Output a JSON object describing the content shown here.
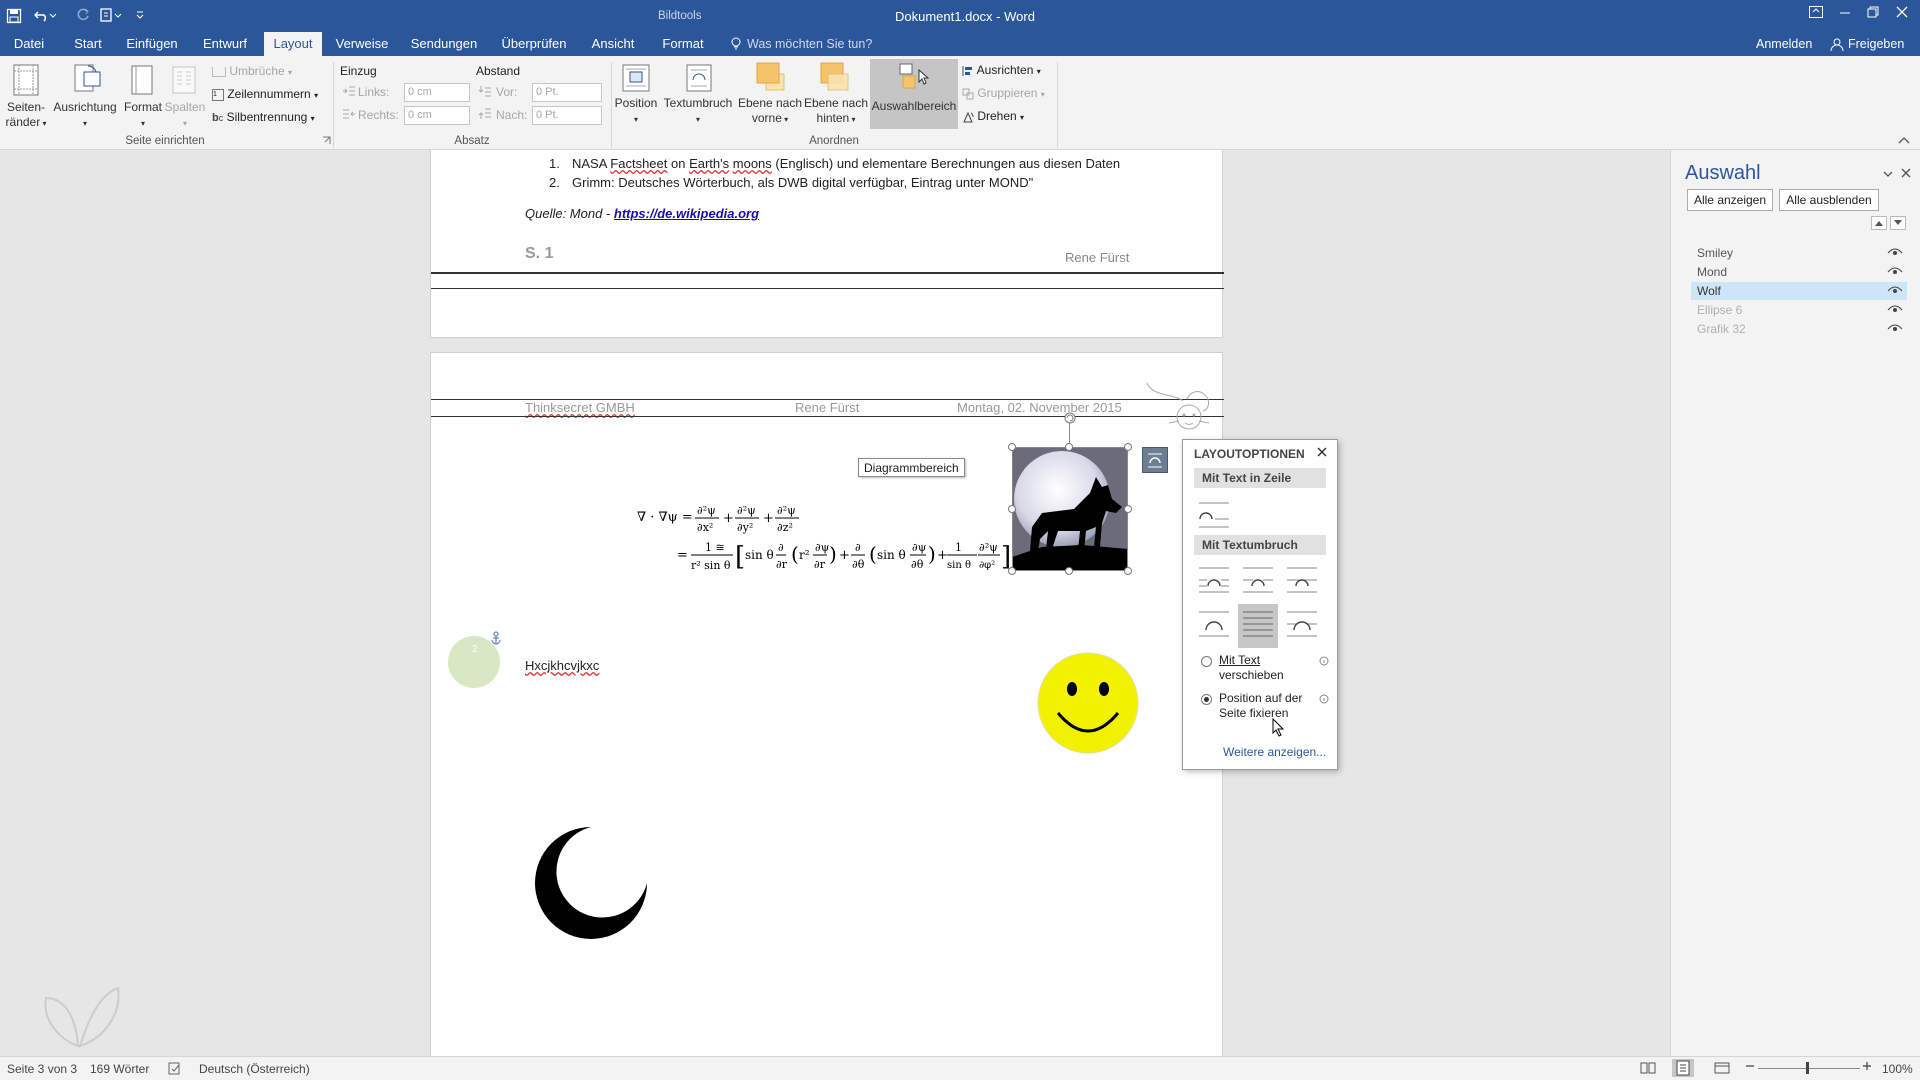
{
  "titlebar": {
    "tool_context": "Bildtools",
    "document_title": "Dokument1.docx - Word"
  },
  "tabs": [
    {
      "label": "Datei"
    },
    {
      "label": "Start"
    },
    {
      "label": "Einfügen"
    },
    {
      "label": "Entwurf"
    },
    {
      "label": "Layout"
    },
    {
      "label": "Verweise"
    },
    {
      "label": "Sendungen"
    },
    {
      "label": "Überprüfen"
    },
    {
      "label": "Ansicht"
    },
    {
      "label": "Format"
    }
  ],
  "tellme": "Was möchten Sie tun?",
  "account": {
    "signin": "Anmelden",
    "share": "Freigeben"
  },
  "ribbon": {
    "seite": {
      "margins": "Seiten-",
      "margins2": "ränder",
      "orientation": "Ausrichtung",
      "size": "Format",
      "columns": "Spalten",
      "breaks": "Umbrüche",
      "line_numbers": "Zeilennummern",
      "hyphenation": "Silbentrennung",
      "group": "Seite einrichten"
    },
    "absatz": {
      "indent": "Einzug",
      "spacing": "Abstand",
      "left": "Links:",
      "right": "Rechts:",
      "before": "Vor:",
      "after": "Nach:",
      "left_val": "0 cm",
      "right_val": "0 cm",
      "before_val": "0 Pt.",
      "after_val": "0 Pt.",
      "group": "Absatz"
    },
    "anordnen": {
      "position": "Position",
      "wrap": "Textumbruch",
      "forward1": "Ebene nach",
      "forward2": "vorne",
      "backward1": "Ebene nach",
      "backward2": "hinten",
      "selection_pane": "Auswahlbereich",
      "align": "Ausrichten",
      "group_btn": "Gruppieren",
      "rotate": "Drehen",
      "group": "Anordnen"
    }
  },
  "page1": {
    "item1_num": "1.",
    "item1_a": "NASA ",
    "item1_b": "Factsheet",
    "item1_c": " on ",
    "item1_d": "Earth's",
    "item1_e": " ",
    "item1_f": "moons",
    "item1_g": " (Englisch) und elementare Berechnungen aus diesen Daten",
    "item2_num": "2.",
    "item2": "Grimm: Deutsches Wörterbuch, als DWB digital verfügbar, Eintrag unter MOND\"",
    "source_prefix": "Quelle: Mond - ",
    "source_link": "https://de.wikipedia.org",
    "footer_page": "S. 1",
    "footer_author": "Rene Fürst"
  },
  "page2": {
    "header_company": "Thinksecret GMBH",
    "header_author": "Rene Fürst",
    "header_date": "Montag, 02. November 2015",
    "chart_area": "Diagrammbereich",
    "body_text": "Hxcjkhcvjkxc",
    "circle_number": "2"
  },
  "layout_options": {
    "title": "LAYOUTOPTIONEN",
    "inline": "Mit Text in Zeile",
    "wrapping": "Mit Textumbruch",
    "move_with_text1": "Mit Text",
    "move_with_text2": "verschieben",
    "fix_position1": "Position auf der",
    "fix_position2": "Seite fixieren",
    "more": "Weitere anzeigen...",
    "selected": "fix_position"
  },
  "selection_pane": {
    "title": "Auswahl",
    "show_all": "Alle anzeigen",
    "hide_all": "Alle ausblenden",
    "items": [
      {
        "name": "Smiley",
        "hidden": false,
        "selected": false
      },
      {
        "name": "Mond",
        "hidden": false,
        "selected": false
      },
      {
        "name": "Wolf",
        "hidden": false,
        "selected": true
      },
      {
        "name": "Ellipse 6",
        "hidden": true,
        "selected": false
      },
      {
        "name": "Grafik 32",
        "hidden": true,
        "selected": false
      }
    ]
  },
  "status": {
    "page": "Seite 3 von 3",
    "words": "169 Wörter",
    "language": "Deutsch (Österreich)",
    "zoom": "100%"
  },
  "colors": {
    "accent": "#2b579a",
    "smiley": "#f2f200",
    "selection_highlight": "#cde6f7"
  }
}
